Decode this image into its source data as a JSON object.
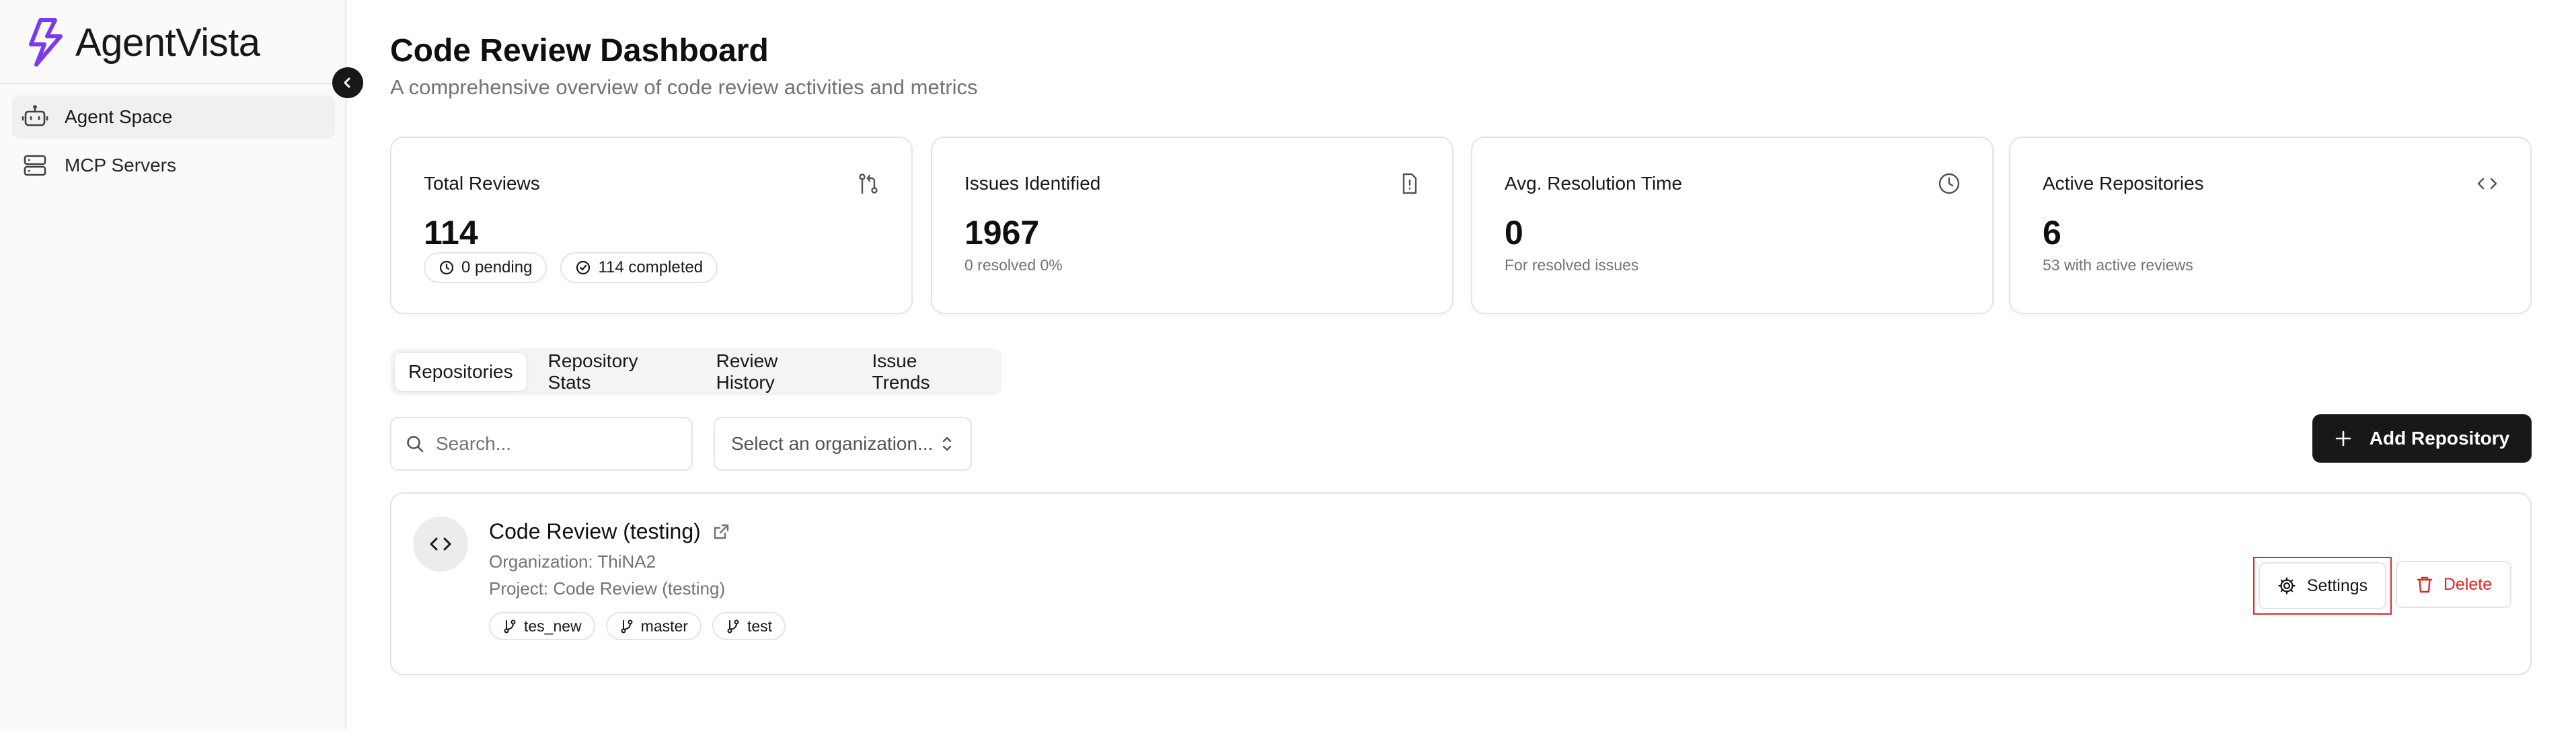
{
  "brand": {
    "name": "AgentVista",
    "accent": "#7c3aed"
  },
  "sidebar": {
    "items": [
      {
        "label": "Agent Space",
        "icon": "robot-icon",
        "active": true
      },
      {
        "label": "MCP Servers",
        "icon": "server-icon",
        "active": false
      }
    ]
  },
  "header": {
    "title": "Code Review Dashboard",
    "subtitle": "A comprehensive overview of code review activities and metrics"
  },
  "stats": {
    "total_reviews": {
      "title": "Total Reviews",
      "value": "114",
      "pending": "0 pending",
      "completed": "114 completed"
    },
    "issues": {
      "title": "Issues Identified",
      "value": "1967",
      "sub": "0 resolved 0%"
    },
    "resolution": {
      "title": "Avg. Resolution Time",
      "value": "0",
      "sub": "For resolved issues"
    },
    "repos": {
      "title": "Active Repositories",
      "value": "6",
      "sub": "53 with active reviews"
    }
  },
  "tabs": [
    {
      "label": "Repositories",
      "active": true
    },
    {
      "label": "Repository Stats",
      "active": false
    },
    {
      "label": "Review History",
      "active": false
    },
    {
      "label": "Issue Trends",
      "active": false
    }
  ],
  "toolbar": {
    "search_placeholder": "Search...",
    "org_select": "Select an organization...",
    "add_label": "Add Repository"
  },
  "repository": {
    "name": "Code Review (testing)",
    "organization": "Organization: ThiNA2",
    "project": "Project: Code Review (testing)",
    "branches": [
      "tes_new",
      "master",
      "test"
    ],
    "settings_label": "Settings",
    "delete_label": "Delete"
  },
  "colors": {
    "danger": "#dc2626",
    "highlight": "#e0262c",
    "dark": "#18181b"
  }
}
